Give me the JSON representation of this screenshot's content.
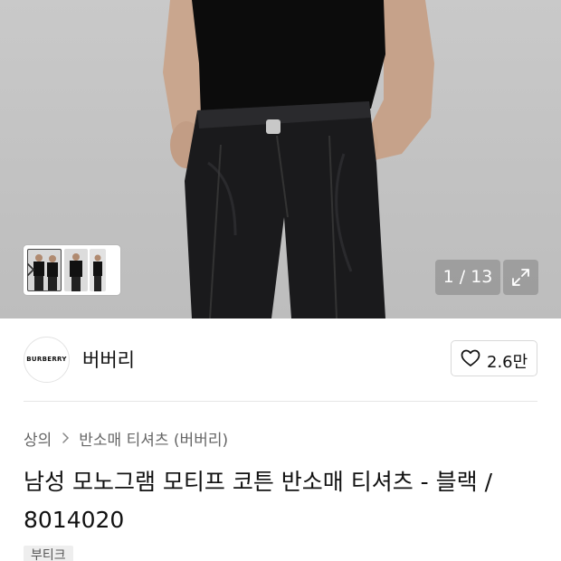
{
  "gallery": {
    "counter": "1 / 13"
  },
  "brand": {
    "logo_text": "BURBERRY",
    "name": "버버리"
  },
  "like": {
    "count": "2.6만"
  },
  "breadcrumb": {
    "items": [
      "상의",
      "반소매 티셔츠 (버버리)"
    ]
  },
  "product": {
    "title_line1": "남성 모노그램 모티프 코튼 반소매 티셔츠 - 블랙 /",
    "title_line2": "8014020",
    "badge": "부티크"
  }
}
